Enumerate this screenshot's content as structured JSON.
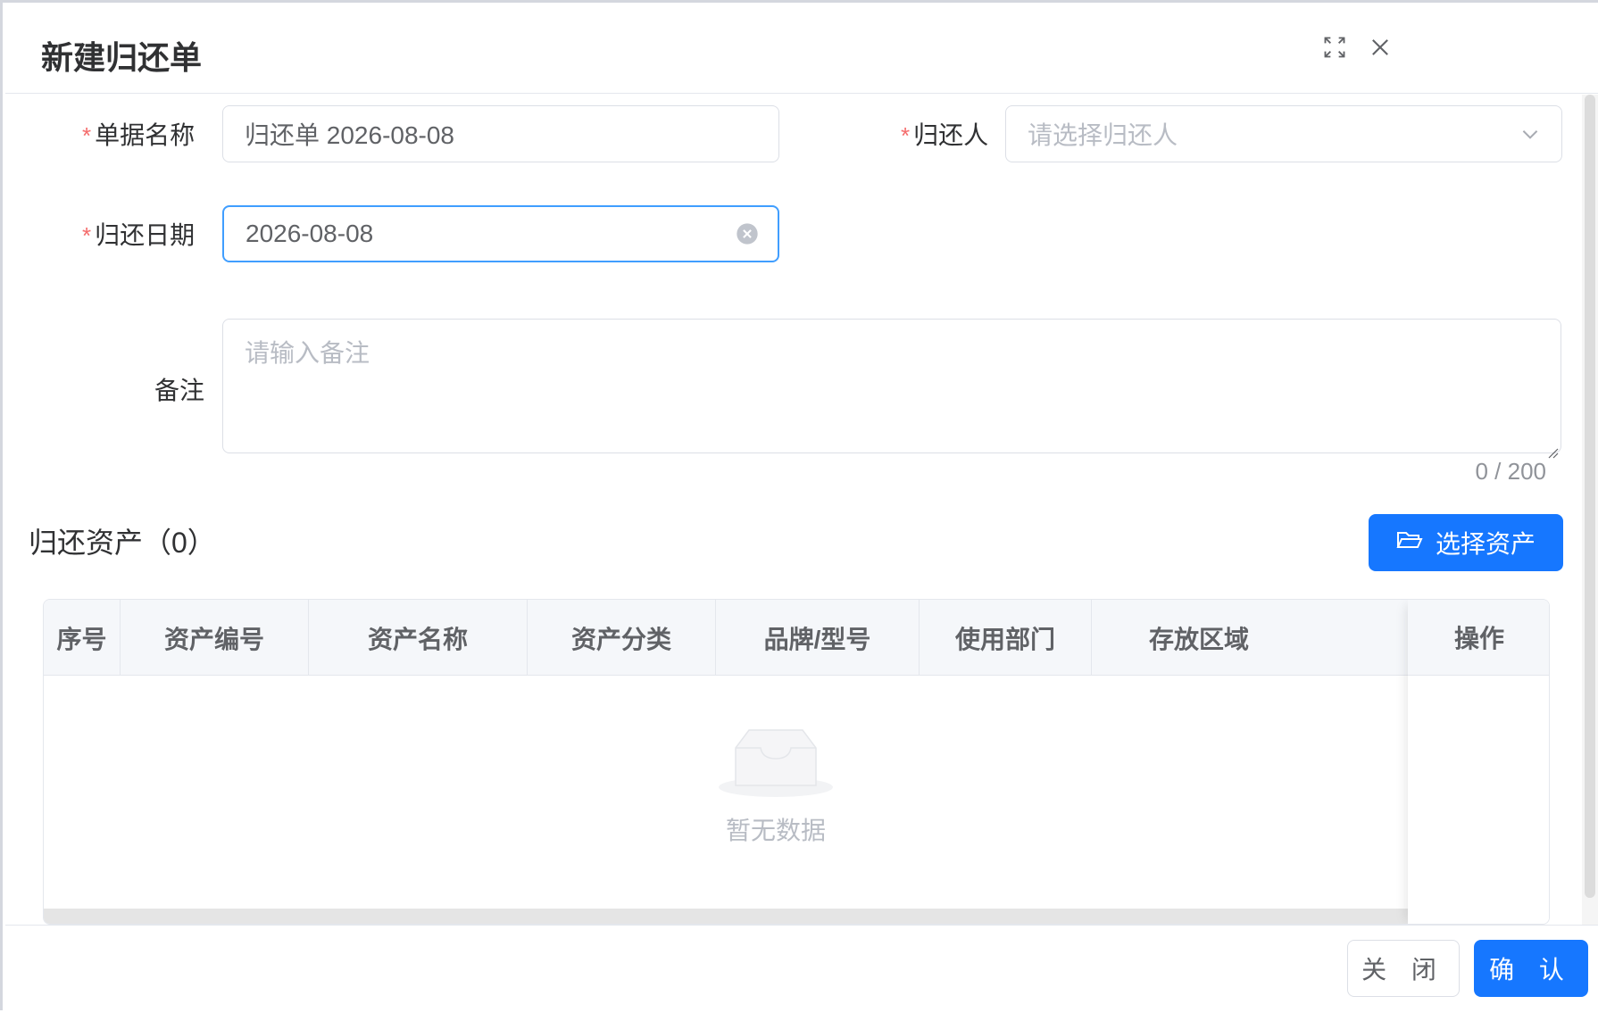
{
  "dialog": {
    "title": "新建归还单",
    "maximize_icon": "fullscreen-icon",
    "close_icon": "close-icon"
  },
  "form": {
    "doc_name": {
      "label": "单据名称",
      "value": "归还单 2026-08-08",
      "required": true
    },
    "returner": {
      "label": "归还人",
      "placeholder": "请选择归还人",
      "required": true
    },
    "return_date": {
      "label": "归还日期",
      "value": "2026-08-08",
      "required": true
    },
    "remark": {
      "label": "备注",
      "placeholder": "请输入备注",
      "counter": "0 / 200"
    }
  },
  "assets": {
    "section_title": "归还资产（0）",
    "select_button": "选择资产",
    "columns": [
      "序号",
      "资产编号",
      "资产名称",
      "资产分类",
      "品牌/型号",
      "使用部门",
      "存放区域"
    ],
    "fixed_column": "操作",
    "rows": [],
    "empty_text": "暂无数据"
  },
  "footer": {
    "close_label": "关 闭",
    "confirm_label": "确 认"
  },
  "colors": {
    "primary": "#1677ff",
    "required_star": "#f56c6c",
    "focus_border": "#409eff"
  }
}
